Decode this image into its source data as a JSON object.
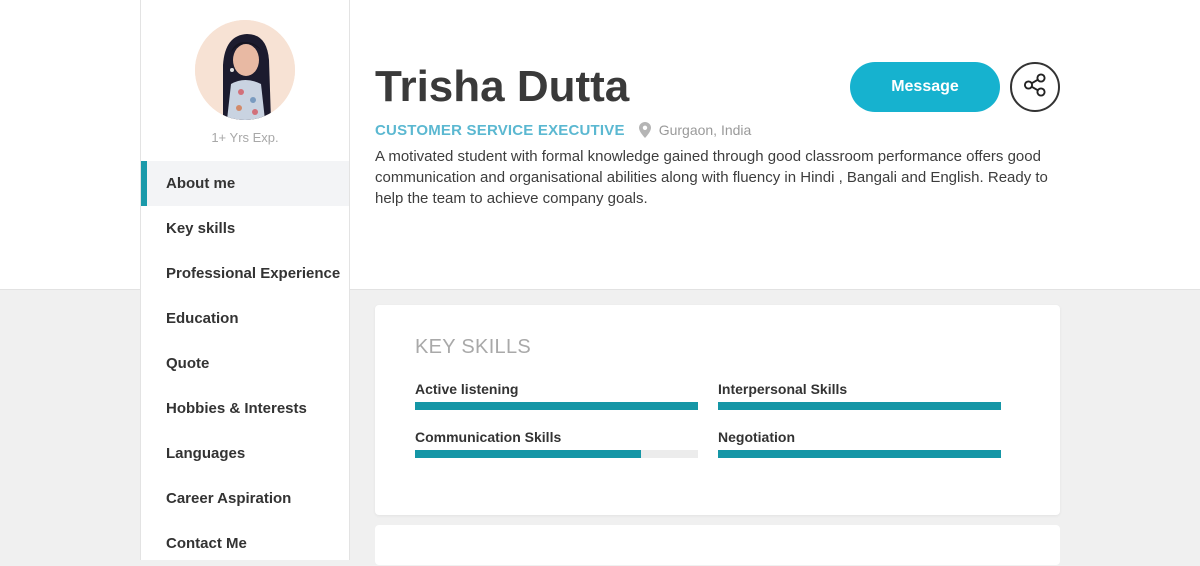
{
  "profile": {
    "name": "Trisha Dutta",
    "job_title": "CUSTOMER SERVICE EXECUTIVE",
    "location": "Gurgaon, India",
    "experience": "1+ Yrs Exp.",
    "bio": "A motivated student with formal knowledge gained through good classroom performance offers good communication and organisational abilities along with fluency in Hindi , Bangali and English. Ready to help the team to achieve company goals."
  },
  "actions": {
    "message_label": "Message",
    "share_icon": "share-icon"
  },
  "nav": {
    "items": [
      {
        "label": "About me",
        "active": true
      },
      {
        "label": "Key skills"
      },
      {
        "label": "Professional Experience"
      },
      {
        "label": "Education"
      },
      {
        "label": "Quote"
      },
      {
        "label": "Hobbies & Interests"
      },
      {
        "label": "Languages"
      },
      {
        "label": "Career Aspiration"
      },
      {
        "label": "Contact Me"
      }
    ]
  },
  "key_skills": {
    "heading": "KEY SKILLS",
    "items": [
      {
        "label": "Active listening",
        "level": 1.0
      },
      {
        "label": "Interpersonal Skills",
        "level": 1.0
      },
      {
        "label": "Communication Skills",
        "level": 0.8
      },
      {
        "label": "Negotiation",
        "level": 1.0
      }
    ]
  },
  "colors": {
    "accent": "#16b2cf",
    "skill_bar": "#1596a6",
    "job_title": "#5bb8d1"
  }
}
